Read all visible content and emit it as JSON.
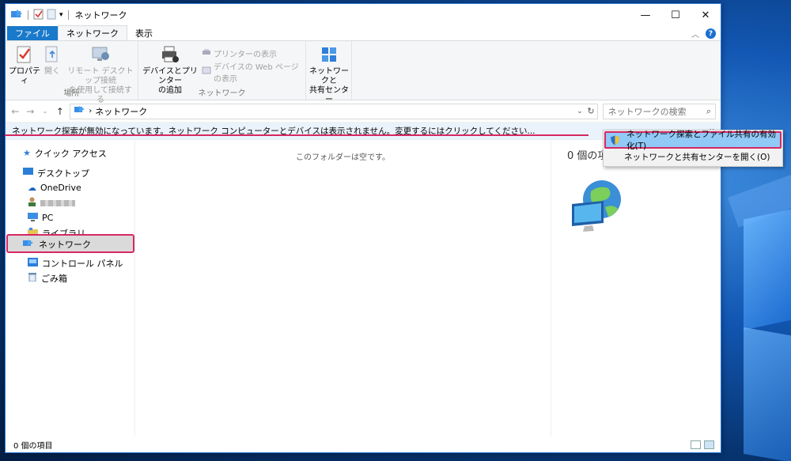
{
  "window": {
    "title": "ネットワーク",
    "controls": {
      "minimize": "—",
      "maximize": "☐",
      "close": "✕"
    }
  },
  "tabs": [
    {
      "label": "ファイル"
    },
    {
      "label": "ネットワーク"
    },
    {
      "label": "表示"
    }
  ],
  "ribbon": {
    "properties": "プロパティ",
    "open": "開く",
    "remote_desktop": [
      "リモート デスクトップ接続",
      "を使用して接続する"
    ],
    "group_location": "場所",
    "add_devices": [
      "デバイスとプリンター",
      "の追加"
    ],
    "show_printers": "プリンターの表示",
    "show_device_web": "デバイスの Web ページの表示",
    "group_network": "ネットワーク",
    "network_center": [
      "ネットワークと",
      "共有センター"
    ]
  },
  "address": {
    "path": "ネットワーク",
    "search_placeholder": "ネットワークの検索"
  },
  "infobar": {
    "text": "ネットワーク探索が無効になっています。ネットワーク コンピューターとデバイスは表示されません。変更するにはクリックしてください..."
  },
  "nav": [
    {
      "label": "クイック アクセス"
    },
    {
      "label": "デスクトップ"
    },
    {
      "label": "OneDrive"
    },
    {
      "label": "PC"
    },
    {
      "label": "ライブラリ"
    },
    {
      "label": "ネットワーク"
    },
    {
      "label": "コントロール パネル"
    },
    {
      "label": "ごみ箱"
    }
  ],
  "main": {
    "empty_text": "このフォルダーは空です。"
  },
  "preview": {
    "count": "0 個の項目"
  },
  "status": {
    "count": "0 個の項目"
  },
  "context_menu": [
    {
      "label": "ネットワーク探索とファイル共有の有効化(T)"
    },
    {
      "label": "ネットワークと共有センターを開く(O)"
    }
  ],
  "colors": {
    "accent": "#1979ca",
    "highlight": "#d62862",
    "menu_hover": "#91c9f7"
  }
}
